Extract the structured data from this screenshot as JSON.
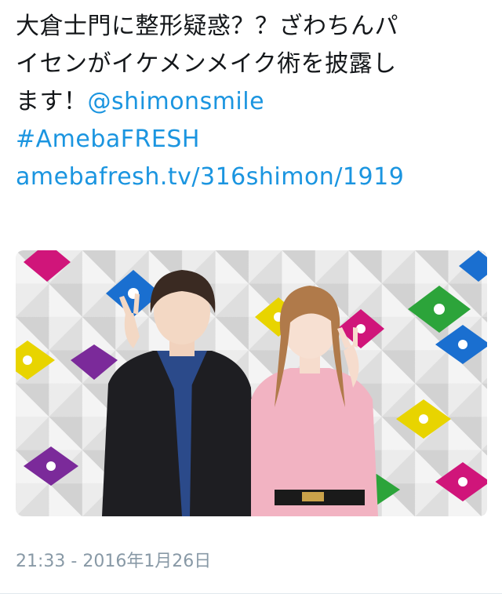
{
  "tweet": {
    "line1": "大倉士門に整形疑惑？？ざわちんパ",
    "line2": "イセンがイケメンメイク術を披露し",
    "line3_text": "ます！",
    "mention": "@shimonsmile",
    "hashtag": "#AmebaFRESH",
    "url": "amebafresh.tv/316shimon/1919"
  },
  "media": {
    "description_icon": "photo-two-people-peace-sign"
  },
  "timestamp": "21:33 - 2016年1月26日",
  "colors": {
    "text": "#14171a",
    "link": "#1b95e0",
    "meta": "#8899a6"
  }
}
